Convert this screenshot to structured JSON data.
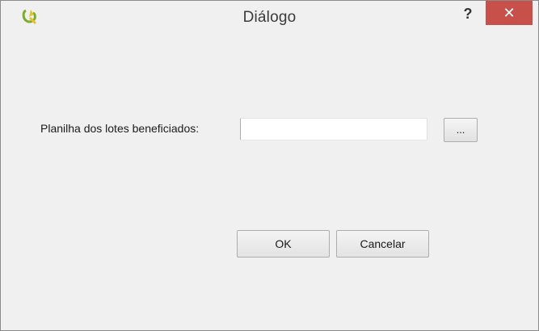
{
  "window": {
    "title": "Diálogo",
    "help_label": "?",
    "close_label": "✕",
    "app_icon": "qgis-icon",
    "close_color": "#c7504a"
  },
  "form": {
    "spreadsheet_label": "Planilha dos lotes beneficiados:",
    "spreadsheet_value": "",
    "browse_label": "..."
  },
  "buttons": {
    "ok_label": "OK",
    "cancel_label": "Cancelar"
  }
}
